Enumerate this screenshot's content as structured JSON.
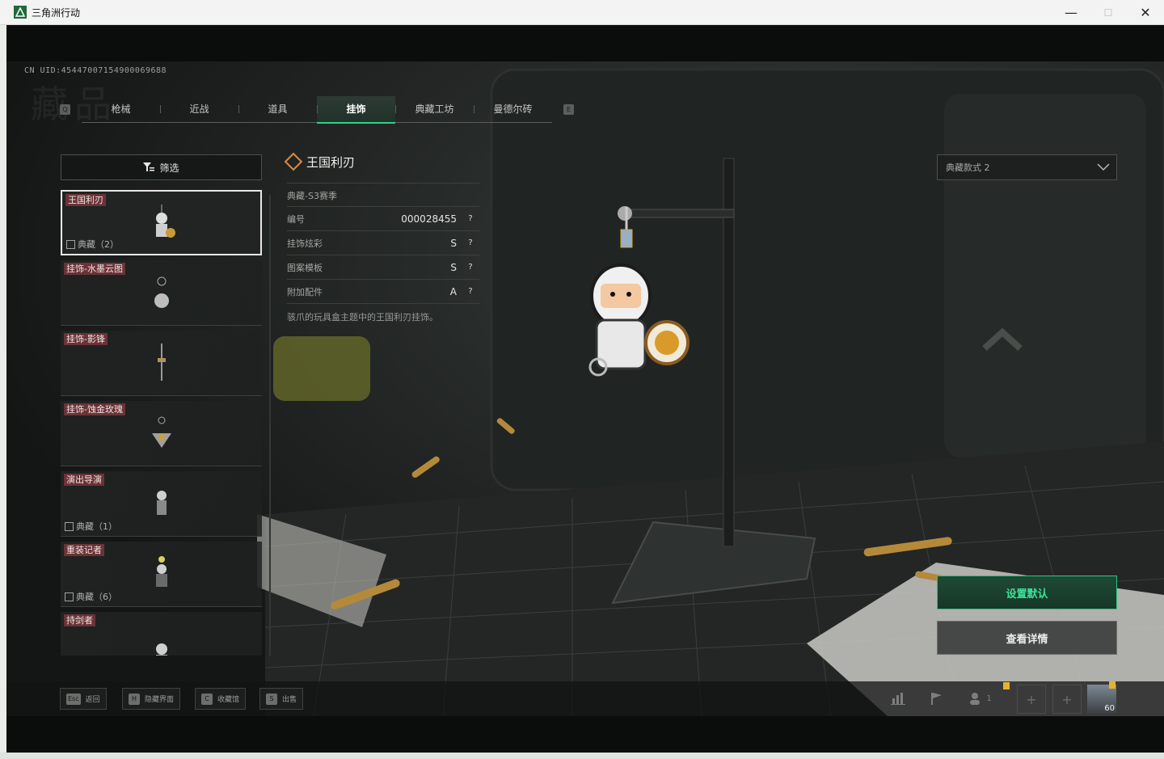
{
  "window": {
    "title": "三角洲行动",
    "controls": {
      "minimize": "—",
      "maximize": "☐",
      "close": "✕"
    }
  },
  "uid": "CN UID:4544700715490006968​8",
  "watermark": "藏品",
  "tabs": {
    "prev_key": "Q",
    "next_key": "E",
    "items": [
      {
        "label": "枪械"
      },
      {
        "label": "近战"
      },
      {
        "label": "道具"
      },
      {
        "label": "挂饰",
        "active": true
      },
      {
        "label": "典藏工坊"
      },
      {
        "label": "曼德尔砖"
      }
    ]
  },
  "filter": {
    "label": "筛选"
  },
  "items": [
    {
      "name": "王国利刃",
      "tag": "典藏（2）",
      "selected": true
    },
    {
      "name": "挂饰-水墨云图",
      "tag": ""
    },
    {
      "name": "挂饰-影锋",
      "tag": ""
    },
    {
      "name": "挂饰-蚀金玫瑰",
      "tag": ""
    },
    {
      "name": "演出导演",
      "tag": "典藏（1）"
    },
    {
      "name": "重装记者",
      "tag": "典藏（6）"
    },
    {
      "name": "持剑者",
      "tag": ""
    }
  ],
  "detail": {
    "title": "王国利刃",
    "subtitle": "典藏-S3赛季",
    "rows": [
      {
        "key": "编号",
        "value": "000028455"
      },
      {
        "key": "挂饰炫彩",
        "value": "S"
      },
      {
        "key": "图案模板",
        "value": "S"
      },
      {
        "key": "附加配件",
        "value": "A"
      }
    ],
    "help": "?",
    "description": "骇爪的玩具盒主题中的王国利刃挂饰。"
  },
  "style_select": {
    "value": "典藏款式 2"
  },
  "actions": {
    "set_default": "设置默认",
    "view_details": "查看详情"
  },
  "hotkeys": [
    {
      "key": "Esc",
      "label": "返回"
    },
    {
      "key": "H",
      "label": "隐藏界面"
    },
    {
      "key": "C",
      "label": "收藏馆"
    },
    {
      "key": "S",
      "label": "出售"
    }
  ],
  "tray": {
    "friends_count": "1",
    "player_level": "60"
  },
  "colors": {
    "accent": "#2fd08a",
    "item_tag_bg": "#6a3336",
    "title_diamond": "#e08a3c"
  }
}
